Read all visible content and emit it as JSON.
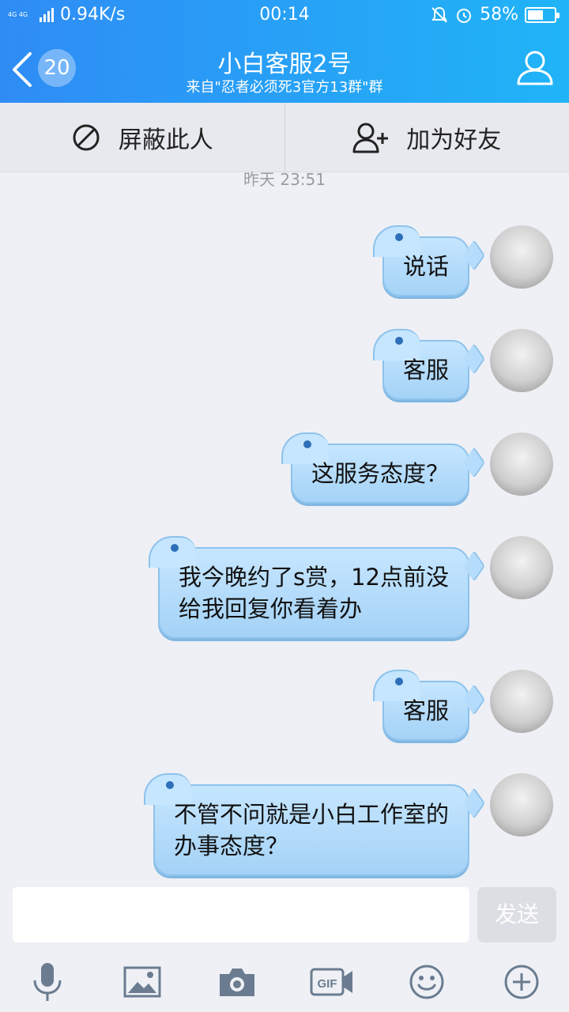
{
  "status_bar": {
    "network": "4G 4G",
    "speed": "0.94K/s",
    "time": "00:14",
    "battery_percent": "58%",
    "battery_level": 0.58
  },
  "nav": {
    "back_badge": "20",
    "title": "小白客服2号",
    "subtitle": "来自\"忍者必须死3官方13群\"群"
  },
  "actions": {
    "block_label": "屏蔽此人",
    "add_friend_label": "加为好友"
  },
  "timestamp": "昨天 23:51",
  "messages": [
    {
      "lines": [
        "说话"
      ]
    },
    {
      "lines": [
        "客服"
      ]
    },
    {
      "lines": [
        "这服务态度？"
      ]
    },
    {
      "lines": [
        "我今晚约了s赏，12点前没",
        "给我回复你看着办"
      ]
    },
    {
      "lines": [
        "客服"
      ]
    },
    {
      "lines": [
        "不管不问就是小白工作室的",
        "办事态度？"
      ]
    }
  ],
  "input": {
    "placeholder": "",
    "send_label": "发送"
  },
  "toolbar": {
    "icons": [
      "microphone-icon",
      "image-icon",
      "camera-icon",
      "gif-icon",
      "emoji-icon",
      "plus-icon"
    ],
    "gif_label": "GIF"
  },
  "colors": {
    "header_start": "#2f8cf5",
    "header_end": "#20b4f7",
    "bubble": "#a4d2f6"
  }
}
